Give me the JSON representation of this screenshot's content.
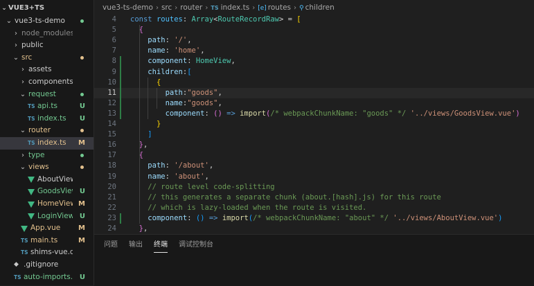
{
  "explorer": {
    "root_label": "VUE3+TS",
    "items": [
      {
        "label": "vue3-ts-demo",
        "kind": "folder-open",
        "depth": 0,
        "status_dot": "#73c991"
      },
      {
        "label": "node_modules",
        "kind": "folder",
        "depth": 1,
        "dim": true
      },
      {
        "label": "public",
        "kind": "folder",
        "depth": 1
      },
      {
        "label": "src",
        "kind": "folder-open",
        "depth": 1,
        "status_dot": "#e2c08d",
        "color": "#e2c08d"
      },
      {
        "label": "assets",
        "kind": "folder",
        "depth": 2
      },
      {
        "label": "components",
        "kind": "folder",
        "depth": 2
      },
      {
        "label": "request",
        "kind": "folder-open",
        "depth": 2,
        "status_dot": "#73c991",
        "color": "#73c991"
      },
      {
        "label": "api.ts",
        "kind": "ts",
        "depth": 3,
        "status": "U",
        "color": "#73c991"
      },
      {
        "label": "index.ts",
        "kind": "ts",
        "depth": 3,
        "status": "U",
        "color": "#73c991"
      },
      {
        "label": "router",
        "kind": "folder-open",
        "depth": 2,
        "status_dot": "#e2c08d",
        "color": "#e2c08d"
      },
      {
        "label": "index.ts",
        "kind": "ts",
        "depth": 3,
        "status": "M",
        "color": "#e2c08d",
        "selected": true
      },
      {
        "label": "type",
        "kind": "folder",
        "depth": 2,
        "status_dot": "#73c991",
        "color": "#73c991"
      },
      {
        "label": "views",
        "kind": "folder-open",
        "depth": 2,
        "status_dot": "#e2c08d",
        "color": "#e2c08d"
      },
      {
        "label": "AboutView.vue",
        "kind": "vue",
        "depth": 3
      },
      {
        "label": "GoodsView....",
        "kind": "vue",
        "depth": 3,
        "status": "U",
        "color": "#73c991"
      },
      {
        "label": "HomeView....",
        "kind": "vue",
        "depth": 3,
        "status": "M",
        "color": "#e2c08d"
      },
      {
        "label": "LoginView.vue",
        "kind": "vue",
        "depth": 3,
        "status": "U",
        "color": "#73c991"
      },
      {
        "label": "App.vue",
        "kind": "vue",
        "depth": 2,
        "status": "M",
        "color": "#e2c08d"
      },
      {
        "label": "main.ts",
        "kind": "ts",
        "depth": 2,
        "status": "M",
        "color": "#e2c08d"
      },
      {
        "label": "shims-vue.d.ts",
        "kind": "ts",
        "depth": 2
      },
      {
        "label": ".gitignore",
        "kind": "git",
        "depth": 1
      },
      {
        "label": "auto-imports.d.ts",
        "kind": "ts",
        "depth": 1,
        "status": "U",
        "color": "#73c991"
      }
    ]
  },
  "breadcrumb": {
    "parts": [
      "vue3-ts-demo",
      "src",
      "router"
    ],
    "file_badge": "TS",
    "file": "index.ts",
    "symbol_badge": "[e]",
    "symbol1": "routes",
    "symbol2_icon": "⚲",
    "symbol2": "children"
  },
  "code": {
    "lines": [
      {
        "n": "4",
        "tokens": [
          [
            "kw",
            "const "
          ],
          [
            "var",
            "routes"
          ],
          [
            "pun",
            ": "
          ],
          [
            "type",
            "Array"
          ],
          [
            "pun",
            "<"
          ],
          [
            "type",
            "RouteRecordRaw"
          ],
          [
            "pun",
            "> = "
          ],
          [
            "b1",
            "["
          ]
        ]
      },
      {
        "n": "5",
        "tokens": [
          [
            "pun",
            "  "
          ],
          [
            "b2",
            "{"
          ]
        ]
      },
      {
        "n": "6",
        "tokens": [
          [
            "pun",
            "    "
          ],
          [
            "prop",
            "path"
          ],
          [
            "pun",
            ": "
          ],
          [
            "str",
            "'/'"
          ],
          [
            "pun",
            ","
          ]
        ]
      },
      {
        "n": "7",
        "tokens": [
          [
            "pun",
            "    "
          ],
          [
            "prop",
            "name"
          ],
          [
            "pun",
            ": "
          ],
          [
            "str",
            "'home'"
          ],
          [
            "pun",
            ","
          ]
        ]
      },
      {
        "n": "8",
        "tokens": [
          [
            "pun",
            "    "
          ],
          [
            "prop",
            "component"
          ],
          [
            "pun",
            ": "
          ],
          [
            "type",
            "HomeView"
          ],
          [
            "pun",
            ","
          ]
        ]
      },
      {
        "n": "9",
        "tokens": [
          [
            "pun",
            "    "
          ],
          [
            "prop",
            "children"
          ],
          [
            "pun",
            ":"
          ],
          [
            "b3",
            "["
          ]
        ]
      },
      {
        "n": "10",
        "tokens": [
          [
            "pun",
            "      "
          ],
          [
            "b1",
            "{"
          ]
        ]
      },
      {
        "n": "11",
        "tokens": [
          [
            "pun",
            "        "
          ],
          [
            "prop",
            "path"
          ],
          [
            "pun",
            ":"
          ],
          [
            "str",
            "\"goods\""
          ],
          [
            "pun",
            ","
          ]
        ],
        "current": true
      },
      {
        "n": "12",
        "tokens": [
          [
            "pun",
            "        "
          ],
          [
            "prop",
            "name"
          ],
          [
            "pun",
            ":"
          ],
          [
            "str",
            "\"goods\""
          ],
          [
            "pun",
            ","
          ]
        ]
      },
      {
        "n": "13",
        "tokens": [
          [
            "pun",
            "        "
          ],
          [
            "prop",
            "component"
          ],
          [
            "pun",
            ": "
          ],
          [
            "b2",
            "()"
          ],
          [
            "pun",
            " "
          ],
          [
            "kw",
            "=>"
          ],
          [
            "pun",
            " "
          ],
          [
            "fn",
            "import"
          ],
          [
            "b2",
            "("
          ],
          [
            "cmt",
            "/* webpackChunkName: \"goods\" */"
          ],
          [
            "pun",
            " "
          ],
          [
            "str",
            "'../views/GoodsView.vue'"
          ],
          [
            "b2",
            ")"
          ]
        ]
      },
      {
        "n": "14",
        "tokens": [
          [
            "pun",
            "      "
          ],
          [
            "b1",
            "}"
          ]
        ]
      },
      {
        "n": "15",
        "tokens": [
          [
            "pun",
            "    "
          ],
          [
            "b3",
            "]"
          ]
        ]
      },
      {
        "n": "16",
        "tokens": [
          [
            "pun",
            "  "
          ],
          [
            "b2",
            "}"
          ],
          [
            "pun",
            ","
          ]
        ]
      },
      {
        "n": "17",
        "tokens": [
          [
            "pun",
            "  "
          ],
          [
            "b2",
            "{"
          ]
        ]
      },
      {
        "n": "18",
        "tokens": [
          [
            "pun",
            "    "
          ],
          [
            "prop",
            "path"
          ],
          [
            "pun",
            ": "
          ],
          [
            "str",
            "'/about'"
          ],
          [
            "pun",
            ","
          ]
        ]
      },
      {
        "n": "19",
        "tokens": [
          [
            "pun",
            "    "
          ],
          [
            "prop",
            "name"
          ],
          [
            "pun",
            ": "
          ],
          [
            "str",
            "'about'"
          ],
          [
            "pun",
            ","
          ]
        ]
      },
      {
        "n": "20",
        "tokens": [
          [
            "pun",
            "    "
          ],
          [
            "cmt",
            "// route level code-splitting"
          ]
        ]
      },
      {
        "n": "21",
        "tokens": [
          [
            "pun",
            "    "
          ],
          [
            "cmt",
            "// this generates a separate chunk (about.[hash].js) for this route"
          ]
        ]
      },
      {
        "n": "22",
        "tokens": [
          [
            "pun",
            "    "
          ],
          [
            "cmt",
            "// which is lazy-loaded when the route is visited."
          ]
        ]
      },
      {
        "n": "23",
        "tokens": [
          [
            "pun",
            "    "
          ],
          [
            "prop",
            "component"
          ],
          [
            "pun",
            ": "
          ],
          [
            "b3",
            "()"
          ],
          [
            "pun",
            " "
          ],
          [
            "kw",
            "=>"
          ],
          [
            "pun",
            " "
          ],
          [
            "fn",
            "import"
          ],
          [
            "b3",
            "("
          ],
          [
            "cmt",
            "/* webpackChunkName: \"about\" */"
          ],
          [
            "pun",
            " "
          ],
          [
            "str",
            "'../views/AboutView.vue'"
          ],
          [
            "b3",
            ")"
          ]
        ]
      },
      {
        "n": "24",
        "tokens": [
          [
            "pun",
            "  "
          ],
          [
            "b2",
            "}"
          ],
          [
            "pun",
            ","
          ]
        ]
      }
    ]
  },
  "panel": {
    "tabs": [
      "问题",
      "输出",
      "终端",
      "调试控制台"
    ],
    "active_index": 2
  }
}
